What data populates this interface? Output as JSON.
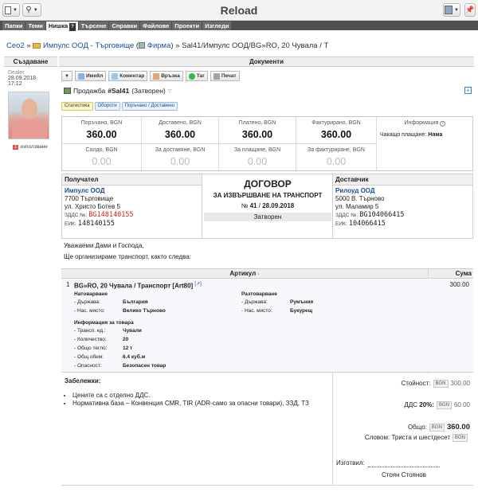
{
  "app": {
    "title": "Reload"
  },
  "nav": {
    "tabs": [
      "Папки",
      "Теми",
      "Нишка",
      "Търсене",
      "Справки",
      "Файлове",
      "Проекти",
      "Изгледи"
    ],
    "help_mark": "?"
  },
  "breadcrumb": {
    "root": "Ceo2",
    "sep1": "»",
    "folder": "Импулс ООД - Търговище",
    "open_paren": "(",
    "folder_type": "Фирма",
    "close_paren": ")",
    "sep2": "»",
    "current": "Sal41/Импулс ООД/BG»RO, 20 Чувала / Т"
  },
  "columns": {
    "left": "Създаване",
    "right": "Документи"
  },
  "creator": {
    "role": "Dealer",
    "date": "28.09.2018",
    "time": "17:12",
    "usage_count": "1",
    "usage_label": "използване"
  },
  "toolbar": {
    "email": "Имейл",
    "comment": "Коментар",
    "link": "Връзка",
    "tag": "Таг",
    "print": "Печат"
  },
  "doc": {
    "prefix": "Продажба",
    "number": "#Sal41",
    "status": "(Затворен)"
  },
  "subtabs": [
    "Статистика",
    "Обороти",
    "Поръчано / Доставено"
  ],
  "stats": {
    "top": [
      {
        "label": "Поръчано, BGN",
        "value": "360.00"
      },
      {
        "label": "Доставено, BGN",
        "value": "360.00"
      },
      {
        "label": "Платено, BGN",
        "value": "360.00"
      },
      {
        "label": "Фактурирано, BGN",
        "value": "360.00"
      }
    ],
    "bottom": [
      {
        "label": "Салдо, BGN",
        "value": "0.00"
      },
      {
        "label": "За доставяне, BGN",
        "value": "0.00"
      },
      {
        "label": "За плащане, BGN",
        "value": "0.00"
      },
      {
        "label": "За фактуриране, BGN",
        "value": "0.00"
      }
    ],
    "info_title": "Информация",
    "pending_label": "Чакащо плащане:",
    "pending_value": "Няма"
  },
  "recipient": {
    "header": "Получател",
    "name": "Импулс ООД",
    "city": "7700 Търговище",
    "street": "ул. Христо Ботев 5",
    "vat_label": "ЗДДС №:",
    "vat": "BG148140155",
    "eik_label": "ЕИК:",
    "eik": "148140155"
  },
  "supplier": {
    "header": "Доставчик",
    "name": "Рилоуд ООД",
    "city": "5000 В. Търново",
    "street": "ул. Маламир 5",
    "vat_label": "ЗДДС №:",
    "vat": "BG104066415",
    "eik_label": "ЕИК:",
    "eik": "104066415"
  },
  "contract": {
    "title": "ДОГОВОР",
    "subtitle": "ЗА ИЗВЪРШВАНЕ НА ТРАНСПОРТ",
    "num_prefix": "№",
    "number": "41",
    "slash": "/",
    "date": "28.09.2018",
    "status": "Затворен"
  },
  "greeting": {
    "line1": "Уважаеми Дами и Господа,",
    "line2": "Ще организираме транспорт, както следва:"
  },
  "items_header": {
    "article": "Артикул",
    "sum": "Сума"
  },
  "item": {
    "num": "1",
    "title": "BG»RO, 20 Чувала / Транспорт",
    "code": "[Art80]",
    "amount": "300.00",
    "loading": {
      "title": "Натоварване",
      "country_label": "- Държава:",
      "country": "България",
      "place_label": "- Нас. място:",
      "place": "Велико Търново"
    },
    "unloading": {
      "title": "Разтоварване",
      "country_label": "- Държава:",
      "country": "Румъния",
      "place_label": "- Нас. място:",
      "place": "Букурещ"
    },
    "cargo": {
      "title": "Информация за товара",
      "rows": [
        {
          "label": "- Трансп. ед.:",
          "value": "Чували"
        },
        {
          "label": "- Количество:",
          "value": "20"
        },
        {
          "label": "- Общо тегло:",
          "value": "12 т"
        },
        {
          "label": "- Общ обем:",
          "value": "6.4 куб.м"
        },
        {
          "label": "- Опасност:",
          "value": "Безопасен товар"
        }
      ]
    }
  },
  "notes": {
    "title": "Забележки:",
    "items": [
      "Цените са с отделно ДДС.",
      "Нормативна база – Конвенция CMR, TIR (ADR-само за опасни товари), ЗЗД, ТЗ"
    ]
  },
  "totals": {
    "value_label": "Стойност:",
    "currency": "BGN",
    "value": "300.00",
    "vat_label": "ДДС",
    "vat_pct": "20%:",
    "vat": "60.00",
    "total_label": "Общо:",
    "total": "360.00",
    "words_label": "Словом:",
    "words": "Триста и шестдесет"
  },
  "signature": {
    "label": "Изготвил:",
    "name": "Стоян Стоянов"
  },
  "colors": {
    "link": "#1a4f9a",
    "vat_red": "#dd2222",
    "nav_bg": "#4f4f4f"
  }
}
